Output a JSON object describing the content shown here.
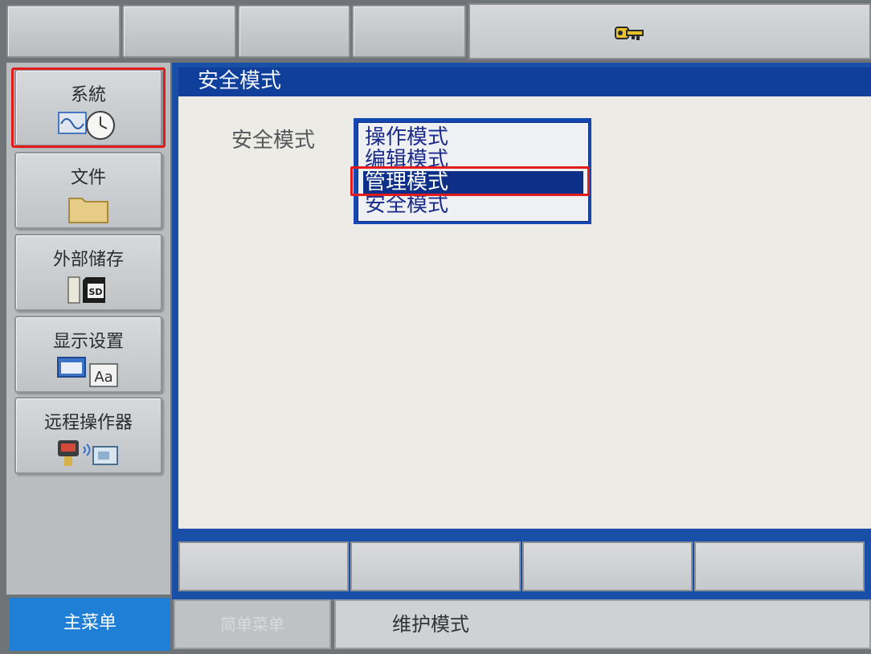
{
  "left_menu": {
    "items": [
      {
        "label": "系統",
        "icon": "waveform-clock-icon"
      },
      {
        "label": "文件",
        "icon": "folder-icon"
      },
      {
        "label": "外部储存",
        "icon": "sd-card-icon"
      },
      {
        "label": "显示设置",
        "icon": "display-font-icon"
      },
      {
        "label": "远程操作器",
        "icon": "remote-device-icon"
      }
    ]
  },
  "window": {
    "title": "安全模式"
  },
  "security_mode": {
    "label": "安全模式",
    "options": [
      "操作模式",
      "编辑模式",
      "管理模式",
      "安全模式"
    ],
    "selected": "管理模式"
  },
  "bottom_bar": {
    "main_menu": "主菜单",
    "sub_menu": "简单菜单",
    "status": "维护模式"
  },
  "colors": {
    "title_bar": "#0e3f9b",
    "selection": "#0d2f88",
    "main_menu": "#1f7fd6",
    "highlight": "#e31b1b"
  }
}
